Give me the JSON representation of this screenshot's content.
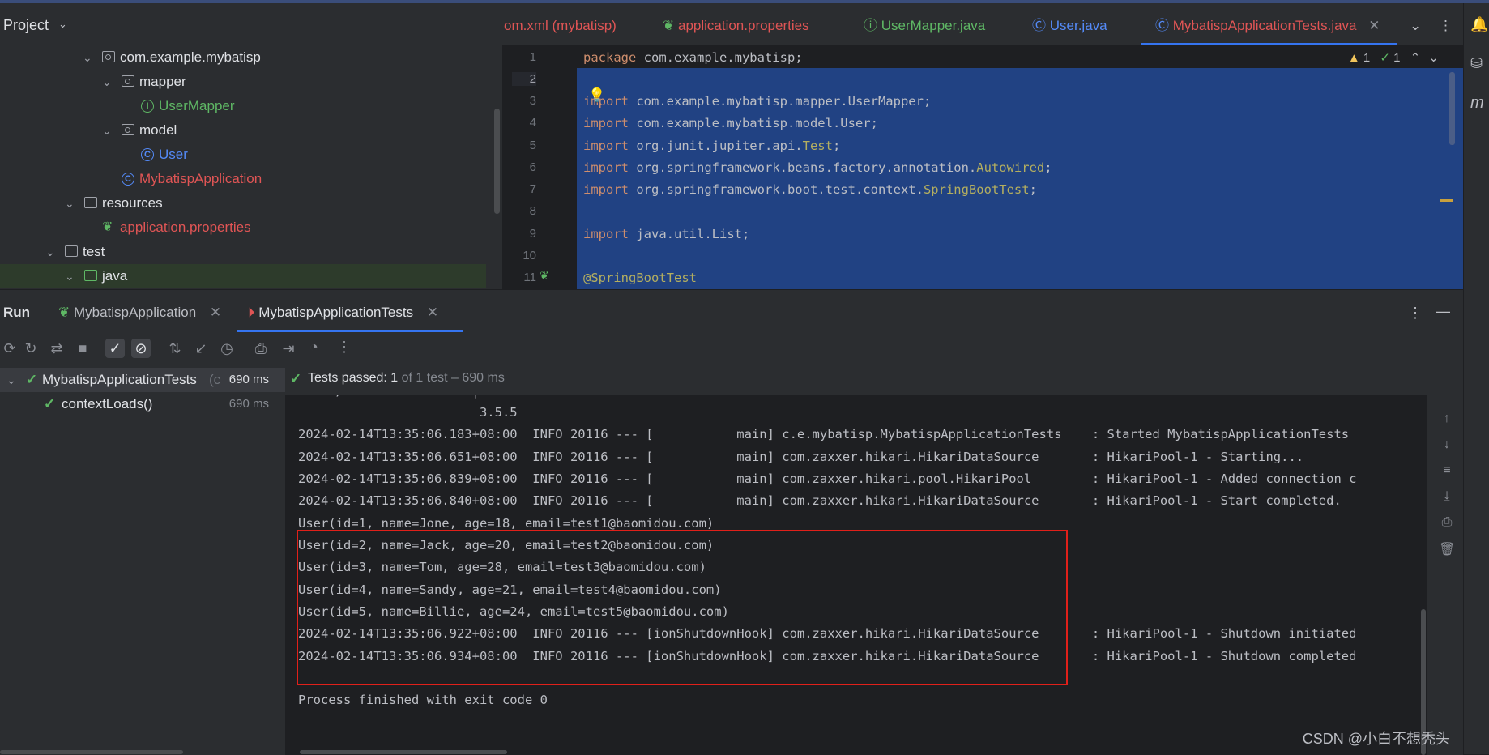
{
  "project": {
    "title": "Project",
    "tree": [
      {
        "label": "com.example.mybatisp"
      },
      {
        "label": "mapper"
      },
      {
        "label": "UserMapper"
      },
      {
        "label": "model"
      },
      {
        "label": "User"
      },
      {
        "label": "MybatispApplication"
      },
      {
        "label": "resources"
      },
      {
        "label": "application.properties"
      },
      {
        "label": "test"
      },
      {
        "label": "java"
      }
    ]
  },
  "editor": {
    "tabs": [
      {
        "label": "om.xml (mybatisp)"
      },
      {
        "label": "application.properties"
      },
      {
        "label": "UserMapper.java"
      },
      {
        "label": "User.java"
      },
      {
        "label": "MybatispApplicationTests.java"
      }
    ],
    "warnings": "1",
    "checks": "1",
    "line_numbers": [
      "1",
      "2",
      "3",
      "4",
      "5",
      "6",
      "7",
      "8",
      "9",
      "10",
      "11"
    ],
    "lines": [
      {
        "kw": "package",
        "rest": " com.example.mybatisp;",
        "ann": "",
        "end": ""
      },
      {
        "kw": "",
        "rest": "",
        "ann": "",
        "end": ""
      },
      {
        "kw": "import",
        "rest": " com.example.mybatisp.mapper.UserMapper;",
        "ann": "",
        "end": ""
      },
      {
        "kw": "import",
        "rest": " com.example.mybatisp.model.User;",
        "ann": "",
        "end": ""
      },
      {
        "kw": "import",
        "rest": " org.junit.jupiter.api.",
        "ann": "Test",
        "end": ";"
      },
      {
        "kw": "import",
        "rest": " org.springframework.beans.factory.annotation.",
        "ann": "Autowired",
        "end": ";"
      },
      {
        "kw": "import",
        "rest": " org.springframework.boot.test.context.",
        "ann": "SpringBootTest",
        "end": ";"
      },
      {
        "kw": "",
        "rest": "",
        "ann": "",
        "end": ""
      },
      {
        "kw": "import",
        "rest": " java.util.List;",
        "ann": "",
        "end": ""
      },
      {
        "kw": "",
        "rest": "",
        "ann": "",
        "end": ""
      },
      {
        "kw": "",
        "rest": "",
        "ann": "@SpringBootTest",
        "end": ""
      }
    ]
  },
  "run": {
    "title": "Run",
    "tabs": [
      {
        "label": "MybatispApplication"
      },
      {
        "label": "MybatispApplicationTests"
      }
    ],
    "tests": [
      {
        "label": "MybatispApplicationTests",
        "suffix": "(c",
        "time": "690 ms"
      },
      {
        "label": "contextLoads()",
        "time": "690 ms"
      }
    ],
    "status_prefix": "Tests passed:",
    "status_count": "1",
    "status_suffix": "of 1 test – 690 ms",
    "console": [
      "     /                 |",
      "                        3.5.5",
      "2024-02-14T13:35:06.183+08:00  INFO 20116 --- [           main] c.e.mybatisp.MybatispApplicationTests    : Started MybatispApplicationTests",
      "2024-02-14T13:35:06.651+08:00  INFO 20116 --- [           main] com.zaxxer.hikari.HikariDataSource       : HikariPool-1 - Starting...",
      "2024-02-14T13:35:06.839+08:00  INFO 20116 --- [           main] com.zaxxer.hikari.pool.HikariPool        : HikariPool-1 - Added connection c",
      "2024-02-14T13:35:06.840+08:00  INFO 20116 --- [           main] com.zaxxer.hikari.HikariDataSource       : HikariPool-1 - Start completed.",
      "User(id=1, name=Jone, age=18, email=test1@baomidou.com)",
      "User(id=2, name=Jack, age=20, email=test2@baomidou.com)",
      "User(id=3, name=Tom, age=28, email=test3@baomidou.com)",
      "User(id=4, name=Sandy, age=21, email=test4@baomidou.com)",
      "User(id=5, name=Billie, age=24, email=test5@baomidou.com)",
      "2024-02-14T13:35:06.922+08:00  INFO 20116 --- [ionShutdownHook] com.zaxxer.hikari.HikariDataSource       : HikariPool-1 - Shutdown initiated",
      "2024-02-14T13:35:06.934+08:00  INFO 20116 --- [ionShutdownHook] com.zaxxer.hikari.HikariDataSource       : HikariPool-1 - Shutdown completed",
      "",
      "Process finished with exit code 0"
    ]
  },
  "watermark": "CSDN @小白不想秃头",
  "colors": {
    "accent": "#3574f0",
    "success": "#5fb865",
    "modified_file": "#e05555",
    "highlight_box": "#e0201a"
  }
}
